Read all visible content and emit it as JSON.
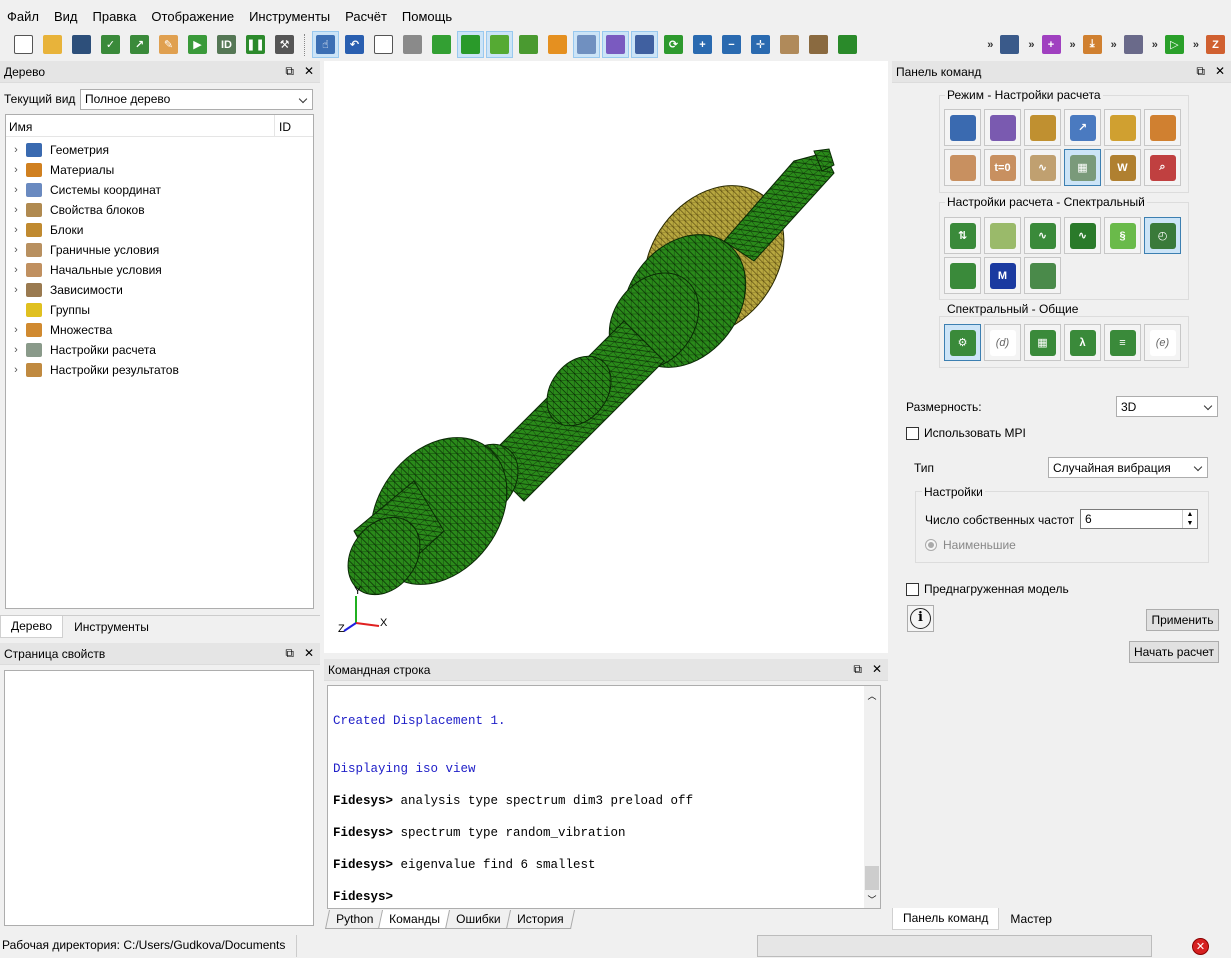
{
  "menu": [
    "Файл",
    "Вид",
    "Правка",
    "Отображение",
    "Инструменты",
    "Расчёт",
    "Помощь"
  ],
  "toolbar": {
    "buttons": [
      {
        "icon": "new-file-icon",
        "color": "#ffffff",
        "glyph": ""
      },
      {
        "icon": "open-folder-icon",
        "color": "#e8b33a",
        "glyph": ""
      },
      {
        "icon": "save-icon",
        "color": "#2d4f7a",
        "glyph": ""
      },
      {
        "icon": "save-as-icon",
        "color": "#3a8a3a",
        "glyph": "✓"
      },
      {
        "icon": "export-icon",
        "color": "#3a8a3a",
        "glyph": "↗"
      },
      {
        "icon": "journal-icon",
        "color": "#e0a050",
        "glyph": "✎"
      },
      {
        "icon": "play-script-icon",
        "color": "#3a9a3a",
        "glyph": "▶"
      },
      {
        "icon": "id-script-icon",
        "color": "#557755",
        "glyph": "ID"
      },
      {
        "icon": "pause-icon",
        "color": "#2c8a2c",
        "glyph": "❚❚"
      },
      {
        "icon": "hammer-icon",
        "color": "#555555",
        "glyph": "⚒"
      },
      {
        "icon": "select-mode-icon",
        "color": "#3c6fb4",
        "glyph": "☝"
      },
      {
        "icon": "undo-icon",
        "color": "#2a5fb0",
        "glyph": "↶"
      },
      {
        "icon": "wireframe-cube-icon",
        "color": "#ffffff",
        "glyph": ""
      },
      {
        "icon": "gray-cube-icon",
        "color": "#8a8a8a",
        "glyph": ""
      },
      {
        "icon": "green-cube-icon",
        "color": "#33a033",
        "glyph": ""
      },
      {
        "icon": "green-solid-cube-icon",
        "color": "#2a9a2a",
        "glyph": ""
      },
      {
        "icon": "green-shapes-icon",
        "color": "#55aa33",
        "glyph": ""
      },
      {
        "icon": "mesh-cube-icon",
        "color": "#4a9a30",
        "glyph": ""
      },
      {
        "icon": "person-icon",
        "color": "#e59020",
        "glyph": ""
      },
      {
        "icon": "axes-grid-icon",
        "color": "#7090c0",
        "glyph": ""
      },
      {
        "icon": "perspective-cube-icon",
        "color": "#7a5ac0",
        "glyph": ""
      },
      {
        "icon": "windows-icon",
        "color": "#4060a0",
        "glyph": ""
      },
      {
        "icon": "refresh-icon",
        "color": "#2e9a2e",
        "glyph": "⟳"
      },
      {
        "icon": "zoom-in-icon",
        "color": "#2a6ab0",
        "glyph": "+"
      },
      {
        "icon": "zoom-out-icon",
        "color": "#2a6ab0",
        "glyph": "−"
      },
      {
        "icon": "zoom-fit-icon",
        "color": "#2a6ab0",
        "glyph": "✛"
      },
      {
        "icon": "box-icon",
        "color": "#b08a5a",
        "glyph": ""
      },
      {
        "icon": "ruler-icon",
        "color": "#8a6a40",
        "glyph": ""
      },
      {
        "icon": "green-cube-view-icon",
        "color": "#2a8a2a",
        "glyph": ""
      }
    ],
    "right_buttons": [
      {
        "icon": "people-icon",
        "color": "#3a5a8a",
        "glyph": ""
      },
      {
        "icon": "crosshair-icon",
        "color": "#a040c0",
        "glyph": "+"
      },
      {
        "icon": "load-arrow-icon",
        "color": "#d08030",
        "glyph": "⤓"
      },
      {
        "icon": "box-select-icon",
        "color": "#6a6a8a",
        "glyph": ""
      },
      {
        "icon": "run-icon",
        "color": "#2aa02a",
        "glyph": "▷"
      },
      {
        "icon": "axis-z-icon",
        "color": "#d06030",
        "glyph": "Z"
      }
    ]
  },
  "tree_panel": {
    "title": "Дерево",
    "view_label": "Текущий вид",
    "view_value": "Полное дерево",
    "col_name": "Имя",
    "col_id": "ID",
    "items": [
      {
        "label": "Геометрия",
        "icon": "geometry-icon",
        "color": "#3a6ab0",
        "arrow": true
      },
      {
        "label": "Материалы",
        "icon": "materials-icon",
        "color": "#d08020",
        "arrow": true
      },
      {
        "label": "Системы координат",
        "icon": "coord-system-icon",
        "color": "#6a8ac0",
        "arrow": true
      },
      {
        "label": "Свойства блоков",
        "icon": "block-props-icon",
        "color": "#b08a50",
        "arrow": true
      },
      {
        "label": "Блоки",
        "icon": "blocks-icon",
        "color": "#c08a30",
        "arrow": true
      },
      {
        "label": "Граничные условия",
        "icon": "boundary-icon",
        "color": "#b89060",
        "arrow": true
      },
      {
        "label": "Начальные условия",
        "icon": "initial-icon",
        "color": "#c09060",
        "arrow": true
      },
      {
        "label": "Зависимости",
        "icon": "dependency-icon",
        "color": "#9a7a50",
        "arrow": true
      },
      {
        "label": "Группы",
        "icon": "groups-icon",
        "color": "#e0c020",
        "arrow": false
      },
      {
        "label": "Множества",
        "icon": "sets-icon",
        "color": "#d08a30",
        "arrow": true
      },
      {
        "label": "Настройки расчета",
        "icon": "calc-settings-icon",
        "color": "#8a9a8a",
        "arrow": true
      },
      {
        "label": "Настройки результатов",
        "icon": "results-icon",
        "color": "#c08a40",
        "arrow": true
      }
    ],
    "tabs": [
      "Дерево",
      "Инструменты"
    ]
  },
  "props_panel": {
    "title": "Страница свойств"
  },
  "cmd_panel": {
    "title": "Командная строка",
    "lines": [
      {
        "text": "Created Displacement 1.",
        "style": "blue"
      },
      {
        "text": "Displaying iso view",
        "style": "blue"
      },
      {
        "prompt": "Fidesys>",
        "text": " analysis type spectrum dim3 preload off",
        "style": "cmd"
      },
      {
        "prompt": "Fidesys>",
        "text": " spectrum type random_vibration",
        "style": "cmd"
      },
      {
        "prompt": "Fidesys>",
        "text": " eigenvalue find 6 smallest",
        "style": "cmd"
      },
      {
        "prompt": "Fidesys>",
        "text": "",
        "style": "cmd"
      }
    ],
    "tabs": [
      "Python",
      "Команды",
      "Ошибки",
      "История"
    ]
  },
  "command_panel": {
    "title": "Панель команд",
    "group1": {
      "label": "Режим - Настройки расчета",
      "icons": [
        {
          "icon": "geometry-mode-icon",
          "color": "#3a6ab0",
          "glyph": ""
        },
        {
          "icon": "mesh-mode-icon",
          "color": "#7a5ab0",
          "glyph": ""
        },
        {
          "icon": "material-mode-icon",
          "color": "#c09030",
          "glyph": ""
        },
        {
          "icon": "coord-mode-icon",
          "color": "#4a7ac0",
          "glyph": "↗"
        },
        {
          "icon": "block-mode-icon",
          "color": "#d0a030",
          "glyph": ""
        },
        {
          "icon": "sets-mode-icon",
          "color": "#d08030",
          "glyph": ""
        },
        {
          "icon": "bc-mode-icon",
          "color": "#c89060",
          "glyph": ""
        },
        {
          "icon": "initial-mode-icon",
          "color": "#c89060",
          "glyph": "t=0"
        },
        {
          "icon": "dependency-mode-icon",
          "color": "#c0a070",
          "glyph": "∿"
        },
        {
          "icon": "calc-mode-icon",
          "color": "#7a9a7a",
          "glyph": "▦"
        },
        {
          "icon": "results-mode-icon",
          "color": "#b08030",
          "glyph": "W"
        },
        {
          "icon": "analysis-mode-icon",
          "color": "#c04040",
          "glyph": "⌕"
        }
      ]
    },
    "group2": {
      "label": "Настройки расчета - Спектральный",
      "icons": [
        {
          "icon": "static-icon",
          "color": "#3a8a3a",
          "glyph": "⇅"
        },
        {
          "icon": "thermal-icon",
          "color": "#9aba6a",
          "glyph": ""
        },
        {
          "icon": "modal-icon",
          "color": "#3a8a3a",
          "glyph": "∿"
        },
        {
          "icon": "harmonic-icon",
          "color": "#2a7a2a",
          "glyph": "∿"
        },
        {
          "icon": "buckling-icon",
          "color": "#6aba4a",
          "glyph": "§"
        },
        {
          "icon": "spectrum-icon",
          "color": "#3a7a3a",
          "glyph": "◴"
        },
        {
          "icon": "cube-icon",
          "color": "#3a8a3a",
          "glyph": ""
        },
        {
          "icon": "autodynamics-icon",
          "color": "#1a3aa0",
          "glyph": "M"
        },
        {
          "icon": "robot-arm-icon",
          "color": "#4a8a4a",
          "glyph": ""
        }
      ]
    },
    "group3": {
      "label": "Спектральный - Общие",
      "icons": [
        {
          "icon": "settings-gear-icon",
          "color": "#3a8a3a",
          "glyph": "⚙"
        },
        {
          "icon": "damping-icon",
          "color": "#ffffff",
          "glyph": "(d)"
        },
        {
          "icon": "matrix-icon",
          "color": "#3a8a3a",
          "glyph": "▦"
        },
        {
          "icon": "lambda-matrix-icon",
          "color": "#3a8a3a",
          "glyph": "λ"
        },
        {
          "icon": "tools-list-icon",
          "color": "#3a8a3a",
          "glyph": "≡"
        },
        {
          "icon": "e-param-icon",
          "color": "#ffffff",
          "glyph": "(e)"
        }
      ]
    },
    "dimension_label": "Размерность:",
    "dimension_value": "3D",
    "mpi_label": "Использовать MPI",
    "mpi_checked": false,
    "type_label": "Тип",
    "type_value": "Случайная вибрация",
    "settings_label": "Настройки",
    "eigen_label": "Число собственных частот",
    "eigen_value": "6",
    "smallest_label": "Наименьшие",
    "prestressed_label": "Преднагруженная модель",
    "prestressed_checked": false,
    "apply_label": "Применить",
    "start_label": "Начать расчет",
    "tabs": [
      "Панель команд",
      "Мастер"
    ]
  },
  "triad": {
    "x": "X",
    "y": "Y",
    "z": "Z"
  },
  "statusbar": {
    "workdir": "Рабочая директория: C:/Users/Gudkova/Documents"
  }
}
